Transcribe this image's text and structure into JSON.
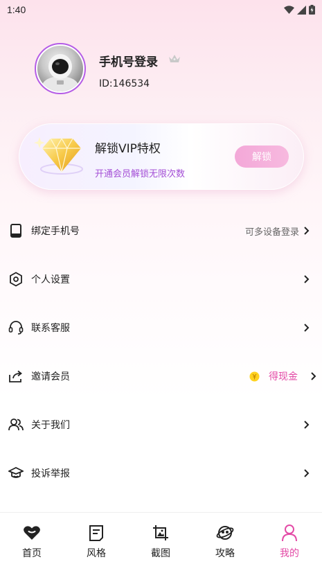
{
  "status_bar": {
    "time": "1:40"
  },
  "profile": {
    "name": "手机号登录",
    "id_text": "ID:146534"
  },
  "vip_card": {
    "title": "解锁VIP特权",
    "subtitle": "开通会员解锁无限次数",
    "button_label": "解锁"
  },
  "menu": {
    "bind_phone": {
      "label": "绑定手机号",
      "extra": "可多设备登录",
      "icon": "phone-icon"
    },
    "settings": {
      "label": "个人设置",
      "icon": "settings-hex-icon"
    },
    "service": {
      "label": "联系客服",
      "icon": "headset-icon"
    },
    "invite": {
      "label": "邀请会员",
      "extra": "得现金",
      "icon": "share-icon"
    },
    "about": {
      "label": "关于我们",
      "icon": "users-icon"
    },
    "report": {
      "label": "投诉举报",
      "icon": "report-icon"
    }
  },
  "bottom_nav": {
    "items": [
      {
        "label": "首页",
        "icon": "heart-icon"
      },
      {
        "label": "风格",
        "icon": "document-icon"
      },
      {
        "label": "截图",
        "icon": "crop-image-icon"
      },
      {
        "label": "攻略",
        "icon": "planet-icon"
      },
      {
        "label": "我的",
        "icon": "person-icon",
        "active": true
      }
    ]
  },
  "colors": {
    "accent_pink": "#e34aa6",
    "accent_purple": "#a44fd6",
    "avatar_ring": "#b45ce6"
  }
}
